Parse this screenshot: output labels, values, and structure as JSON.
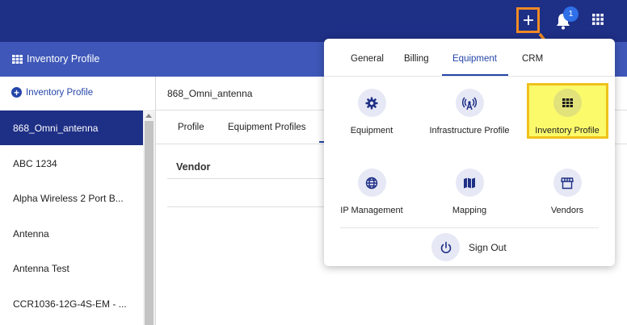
{
  "colors": {
    "topbar": "#1e2f86",
    "subbar": "#3e57b8",
    "accent": "#2445a8",
    "annotation_orange": "#f08a24",
    "highlight_yellow": "#fbfa6b"
  },
  "topbar": {
    "plus_icon": "plus-icon",
    "bell_icon": "bell-icon",
    "notification_count": "1",
    "apps_icon": "grid-icon"
  },
  "page": {
    "title": "Inventory Profile",
    "title_icon": "grid-icon"
  },
  "sidebar": {
    "add_label": "Inventory Profile",
    "items": [
      {
        "label": "868_Omni_antenna",
        "active": true
      },
      {
        "label": "ABC 1234"
      },
      {
        "label": "Alpha Wireless 2 Port B..."
      },
      {
        "label": "Antenna"
      },
      {
        "label": "Antenna Test"
      },
      {
        "label": "CCR1036-12G-4S-EM - ..."
      }
    ]
  },
  "main": {
    "breadcrumb": "868_Omni_antenna",
    "tabs": [
      "Profile",
      "Equipment Profiles"
    ],
    "vendor_label": "Vendor"
  },
  "menu": {
    "tabs": [
      "General",
      "Billing",
      "Equipment",
      "CRM"
    ],
    "active_tab": "Equipment",
    "tiles": [
      {
        "label": "Equipment",
        "icon": "gear-icon"
      },
      {
        "label": "Infrastructure Profile",
        "icon": "antenna-icon"
      },
      {
        "label": "Inventory Profile",
        "icon": "grid-icon",
        "highlighted": true
      },
      {
        "label": "IP Management",
        "icon": "globe-icon"
      },
      {
        "label": "Mapping",
        "icon": "map-icon"
      },
      {
        "label": "Vendors",
        "icon": "store-icon"
      }
    ],
    "signout_label": "Sign Out",
    "signout_icon": "power-icon"
  }
}
